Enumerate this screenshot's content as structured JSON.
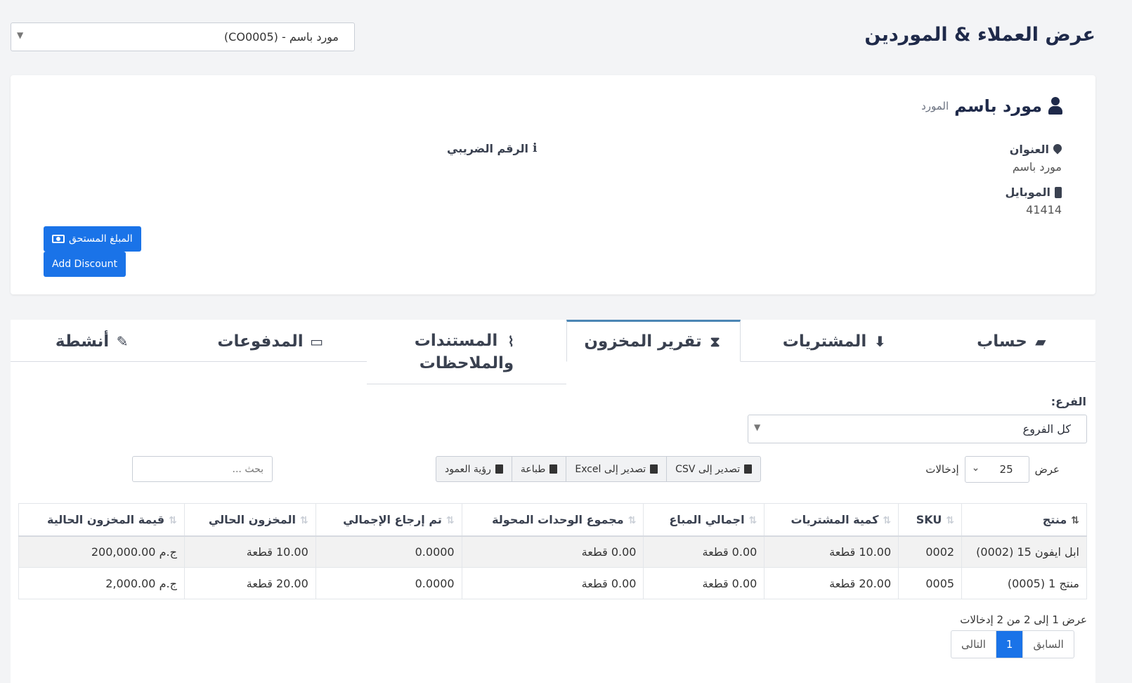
{
  "page": {
    "title": "عرض العملاء & الموردين",
    "contact_select": "مورد باسم - (CO0005)"
  },
  "contact": {
    "name": "مورد باسم",
    "type": "المورد",
    "address_label": "العنوان",
    "address_value": "مورد باسم",
    "mobile_label": "الموبايل",
    "mobile_value": "41414",
    "tax_label": "الرقم الضريبي",
    "due_button": "المبلغ المستحق",
    "discount_button": "Add Discount"
  },
  "tabs": [
    {
      "label": "حساب",
      "icon": "ledger-icon"
    },
    {
      "label": "المشتريات",
      "icon": "arrow-circle-down-icon"
    },
    {
      "label": "تقرير المخزون",
      "icon": "hourglass-icon",
      "active": true
    },
    {
      "label": "المستندات والملاحظات",
      "line1": "المستندات",
      "line2": "والملاحظات",
      "icon": "paperclip-icon"
    },
    {
      "label": "المدفوعات",
      "icon": "money-bill-icon"
    },
    {
      "label": "أنشطة",
      "icon": "edit-icon"
    }
  ],
  "filters": {
    "branch_label": "الفرع:",
    "branch_value": "كل الفروع"
  },
  "datatable": {
    "length_prefix": "عرض",
    "length_value": "25",
    "length_suffix": "إدخالات",
    "buttons": {
      "csv": "تصدير إلى CSV",
      "excel": "تصدير إلى Excel",
      "print": "طباعة",
      "colvis": "رؤية العمود"
    },
    "search_placeholder": "بحث ...",
    "columns": [
      "منتج",
      "SKU",
      "كمية المشتريات",
      "اجمالي المباع",
      "مجموع الوحدات المحولة",
      "تم إرجاع الإجمالي",
      "المخزون الحالي",
      "قيمة المخزون الحالية"
    ],
    "rows": [
      [
        "ابل ايفون 15 (0002)",
        "0002",
        "10.00 قطعة",
        "0.00 قطعة",
        "0.00 قطعة",
        "0.0000",
        "10.00 قطعة",
        "ج.م 200,000.00"
      ],
      [
        "منتج 1 (0005)",
        "0005",
        "20.00 قطعة",
        "0.00 قطعة",
        "0.00 قطعة",
        "0.0000",
        "20.00 قطعة",
        "ج.م 2,000.00"
      ]
    ],
    "info": "عرض 1 إلى 2 من 2 إدخالات",
    "pagination": {
      "prev": "السابق",
      "current": "1",
      "next": "التالى"
    }
  },
  "colors": {
    "primary": "#1a73e8",
    "active_tab_border": "#4b86b4",
    "heading": "#1f2a4a"
  }
}
